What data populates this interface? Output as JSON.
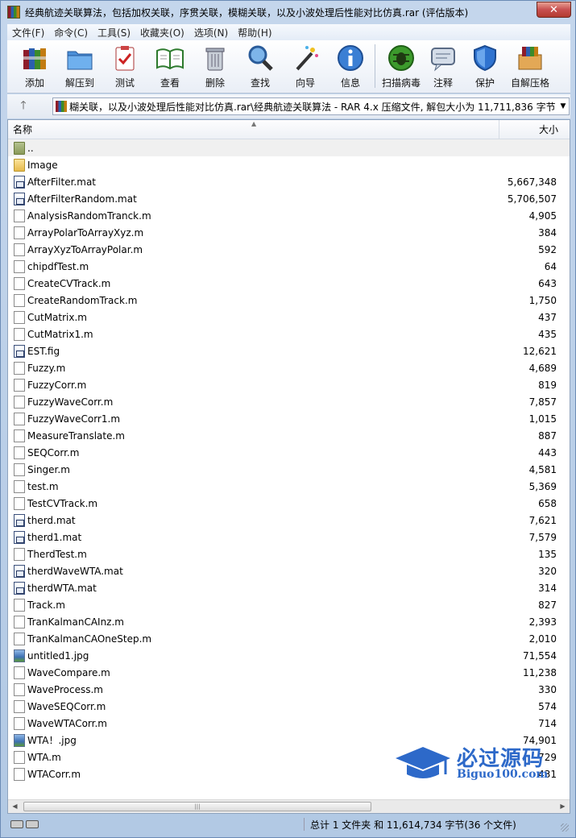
{
  "window": {
    "title": "经典航迹关联算法，包括加权关联，序贯关联，模糊关联，以及小波处理后性能对比仿真.rar (评估版本)",
    "close_label": "✕"
  },
  "menu": [
    "文件(F)",
    "命令(C)",
    "工具(S)",
    "收藏夹(O)",
    "选项(N)",
    "帮助(H)"
  ],
  "toolbar": {
    "add": "添加",
    "extract": "解压到",
    "test": "测试",
    "view": "查看",
    "delete": "删除",
    "find": "查找",
    "wizard": "向导",
    "info": "信息",
    "scan": "扫描病毒",
    "comment": "注释",
    "protect": "保护",
    "sfx": "自解压格"
  },
  "address": {
    "up_label": "🡑",
    "path": "糊关联，以及小波处理后性能对比仿真.rar\\经典航迹关联算法 - RAR 4.x 压缩文件, 解包大小为 11,711,836 字节",
    "dropdown": "▼"
  },
  "columns": {
    "name": "名称",
    "size": "大小",
    "sort_arrow": "▲"
  },
  "files": [
    {
      "name": "..",
      "size": "",
      "type": "parent"
    },
    {
      "name": "Image",
      "size": "",
      "type": "folder"
    },
    {
      "name": "AfterFilter.mat",
      "size": "5,667,348",
      "type": "mat"
    },
    {
      "name": "AfterFilterRandom.mat",
      "size": "5,706,507",
      "type": "mat"
    },
    {
      "name": "AnalysisRandomTranck.m",
      "size": "4,905",
      "type": "doc"
    },
    {
      "name": "ArrayPolarToArrayXyz.m",
      "size": "384",
      "type": "doc"
    },
    {
      "name": "ArrayXyzToArrayPolar.m",
      "size": "592",
      "type": "doc"
    },
    {
      "name": "chipdfTest.m",
      "size": "64",
      "type": "doc"
    },
    {
      "name": "CreateCVTrack.m",
      "size": "643",
      "type": "doc"
    },
    {
      "name": "CreateRandomTrack.m",
      "size": "1,750",
      "type": "doc"
    },
    {
      "name": "CutMatrix.m",
      "size": "437",
      "type": "doc"
    },
    {
      "name": "CutMatrix1.m",
      "size": "435",
      "type": "doc"
    },
    {
      "name": "EST.fig",
      "size": "12,621",
      "type": "mat"
    },
    {
      "name": "Fuzzy.m",
      "size": "4,689",
      "type": "doc"
    },
    {
      "name": "FuzzyCorr.m",
      "size": "819",
      "type": "doc"
    },
    {
      "name": "FuzzyWaveCorr.m",
      "size": "7,857",
      "type": "doc"
    },
    {
      "name": "FuzzyWaveCorr1.m",
      "size": "1,015",
      "type": "doc"
    },
    {
      "name": "MeasureTranslate.m",
      "size": "887",
      "type": "doc"
    },
    {
      "name": "SEQCorr.m",
      "size": "443",
      "type": "doc"
    },
    {
      "name": "Singer.m",
      "size": "4,581",
      "type": "doc"
    },
    {
      "name": "test.m",
      "size": "5,369",
      "type": "doc"
    },
    {
      "name": "TestCVTrack.m",
      "size": "658",
      "type": "doc"
    },
    {
      "name": "therd.mat",
      "size": "7,621",
      "type": "mat"
    },
    {
      "name": "therd1.mat",
      "size": "7,579",
      "type": "mat"
    },
    {
      "name": "TherdTest.m",
      "size": "135",
      "type": "doc"
    },
    {
      "name": "therdWaveWTA.mat",
      "size": "320",
      "type": "mat"
    },
    {
      "name": "therdWTA.mat",
      "size": "314",
      "type": "mat"
    },
    {
      "name": "Track.m",
      "size": "827",
      "type": "doc"
    },
    {
      "name": "TranKalmanCAInz.m",
      "size": "2,393",
      "type": "doc"
    },
    {
      "name": "TranKalmanCAOneStep.m",
      "size": "2,010",
      "type": "doc"
    },
    {
      "name": "untitled1.jpg",
      "size": "71,554",
      "type": "img"
    },
    {
      "name": "WaveCompare.m",
      "size": "11,238",
      "type": "doc"
    },
    {
      "name": "WaveProcess.m",
      "size": "330",
      "type": "doc"
    },
    {
      "name": "WaveSEQCorr.m",
      "size": "574",
      "type": "doc"
    },
    {
      "name": "WaveWTACorr.m",
      "size": "714",
      "type": "doc"
    },
    {
      "name": "WTA！.jpg",
      "size": "74,901",
      "type": "img"
    },
    {
      "name": "WTA.m",
      "size": "729",
      "type": "doc"
    },
    {
      "name": "WTACorr.m",
      "size": "431",
      "type": "doc"
    }
  ],
  "watermark": {
    "title": "必过源码",
    "subtitle": "Biguo100.com"
  },
  "scrollbar": {
    "left": "◀",
    "right": "▶",
    "grip": "|||"
  },
  "status": {
    "text": "总计 1 文件夹 和 11,614,734 字节(36 个文件)"
  }
}
